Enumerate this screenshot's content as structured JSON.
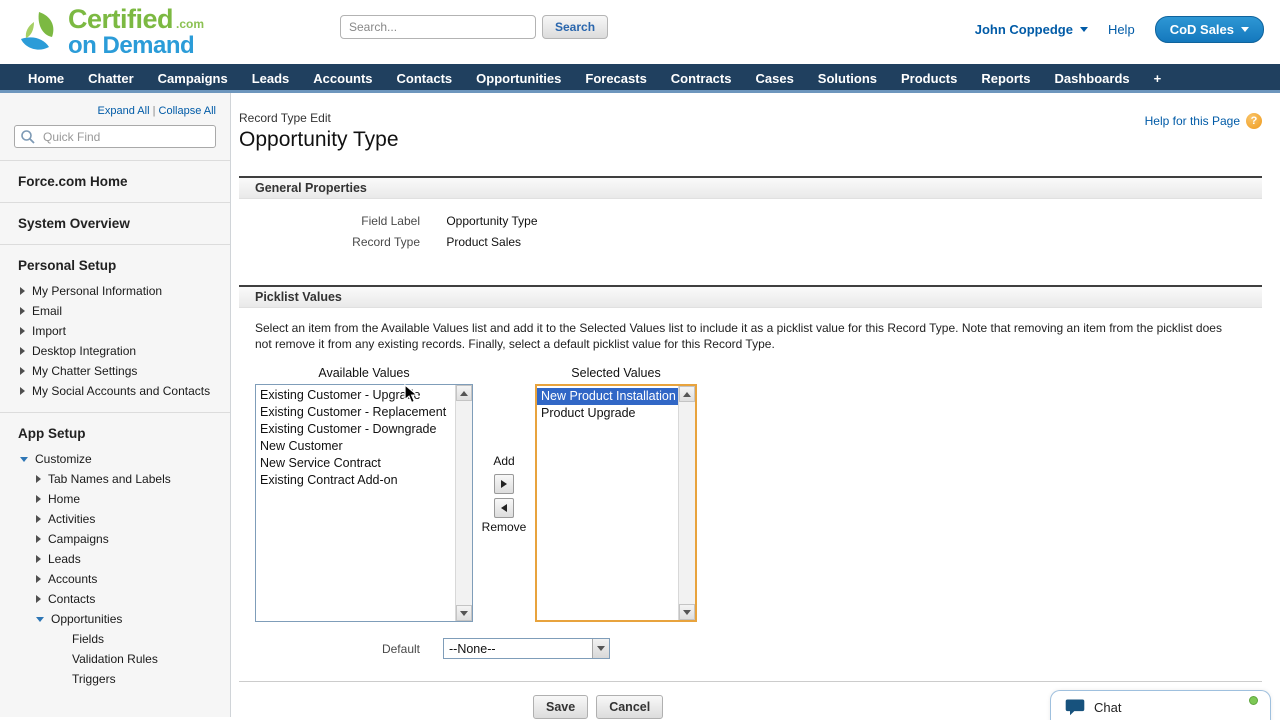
{
  "colors": {
    "tab_bar": "#20405f",
    "tab_underline": "#6d96bd",
    "link_blue": "#015ba7",
    "app_button_blue": "#1478bd",
    "logo_green": "#7cb942",
    "logo_blue": "#2b9cd8",
    "selected_item_bg": "#3167c6",
    "selected_listbox_border": "#e8a33d",
    "help_icon_orange": "#ef9a1d",
    "chat_status_green": "#7dc855"
  },
  "header": {
    "logo_title": "Certified",
    "logo_suffix": ".com",
    "logo_subtitle": "on Demand",
    "search_placeholder": "Search...",
    "search_button": "Search",
    "user_name": "John Coppedge",
    "help": "Help",
    "app_name": "CoD Sales"
  },
  "nav_tabs": [
    "Home",
    "Chatter",
    "Campaigns",
    "Leads",
    "Accounts",
    "Contacts",
    "Opportunities",
    "Forecasts",
    "Contracts",
    "Cases",
    "Solutions",
    "Products",
    "Reports",
    "Dashboards",
    "+"
  ],
  "sidebar": {
    "expand_all": "Expand All",
    "divider": "|",
    "collapse_all": "Collapse All",
    "quick_find_placeholder": "Quick Find",
    "force_home": "Force.com Home",
    "system_overview": "System Overview",
    "personal_setup_title": "Personal Setup",
    "personal_setup_items": [
      "My Personal Information",
      "Email",
      "Import",
      "Desktop Integration",
      "My Chatter Settings",
      "My Social Accounts and Contacts"
    ],
    "app_setup_title": "App Setup",
    "customize_label": "Customize",
    "customize_items": [
      "Tab Names and Labels",
      "Home",
      "Activities",
      "Campaigns",
      "Leads",
      "Accounts",
      "Contacts",
      "Opportunities"
    ],
    "opportunities_children": [
      "Fields",
      "Validation Rules",
      "Triggers"
    ]
  },
  "main": {
    "record_type_edit": "Record Type Edit",
    "title": "Opportunity Type",
    "help_for_page": "Help for this Page",
    "general": {
      "section_title": "General Properties",
      "field_label_label": "Field Label",
      "field_label_value": "Opportunity Type",
      "record_type_label": "Record Type",
      "record_type_value": "Product Sales"
    },
    "picklist": {
      "section_title": "Picklist Values",
      "description": "Select an item from the Available Values list and add it to the Selected Values list to include it as a picklist value for this Record Type. Note that removing an item from the picklist does not remove it from any existing records. Finally, select a default picklist value for this Record Type.",
      "available_label": "Available Values",
      "selected_label": "Selected Values",
      "available_items": [
        "Existing Customer - Upgrade",
        "Existing Customer - Replacement",
        "Existing Customer - Downgrade",
        "New Customer",
        "New Service Contract",
        "Existing Contract Add-on"
      ],
      "selected_items": [
        "New Product Installation",
        "Product Upgrade"
      ],
      "add_label": "Add",
      "remove_label": "Remove",
      "default_label": "Default",
      "default_value": "--None--"
    },
    "buttons": {
      "save": "Save",
      "cancel": "Cancel"
    }
  },
  "chat": {
    "label": "Chat"
  }
}
